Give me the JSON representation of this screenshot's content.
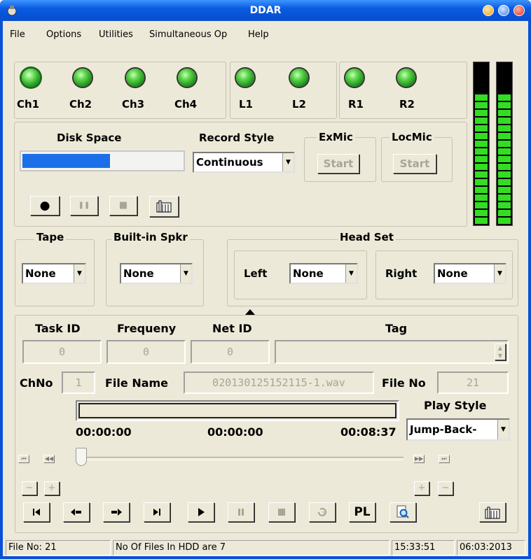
{
  "window": {
    "title": "DDAR"
  },
  "menu": [
    "File",
    "Options",
    "Utilities",
    "Simultaneous Op",
    "Help"
  ],
  "channels": [
    "Ch1",
    "Ch2",
    "Ch3",
    "Ch4",
    "L1",
    "L2",
    "R1",
    "R2"
  ],
  "record": {
    "disk_space_label": "Disk Space",
    "disk_space_fraction": 0.55,
    "record_style_label": "Record Style",
    "record_style_value": "Continuous",
    "exmic_label": "ExMic",
    "locmic_label": "LocMic",
    "start_label": "Start",
    "record_icon": "●",
    "pause_icon": "❚❚",
    "stop_icon": "■",
    "folder_icon": "folder-icon"
  },
  "tape": {
    "label": "Tape",
    "value": "None"
  },
  "speaker": {
    "label": "Built-in Spkr",
    "value": "None"
  },
  "headset": {
    "label": "Head Set",
    "left_label": "Left",
    "left_value": "None",
    "right_label": "Right",
    "right_value": "None"
  },
  "details": {
    "task_id_label": "Task ID",
    "task_id_value": "0",
    "frequency_label": "Frequeny",
    "frequency_value": "0",
    "net_id_label": "Net ID",
    "net_id_value": "0",
    "tag_label": "Tag",
    "tag_value": "",
    "chno_label": "ChNo",
    "chno_value": "1",
    "file_name_label": "File Name",
    "file_name_value": "020130125152115-1.wav",
    "file_no_label": "File No",
    "file_no_value": "21"
  },
  "playback": {
    "time_start": "00:00:00",
    "time_current": "00:00:00",
    "time_total": "00:08:37",
    "play_style_label": "Play Style",
    "play_style_value": "Jump-Back-",
    "pl_label": "PL",
    "minus_label": "−",
    "plus_label": "+",
    "slider_position": 0
  },
  "statusbar": {
    "file_no": "File No: 21",
    "files_in_hdd": "No Of Files In HDD are 7",
    "time": "15:33:51",
    "date": "06:03:2013"
  },
  "colors": {
    "titlebar": "#0a5be0",
    "led_green": "#33dd22",
    "progress": "#1b6fe8",
    "panel": "#ece9d8"
  }
}
